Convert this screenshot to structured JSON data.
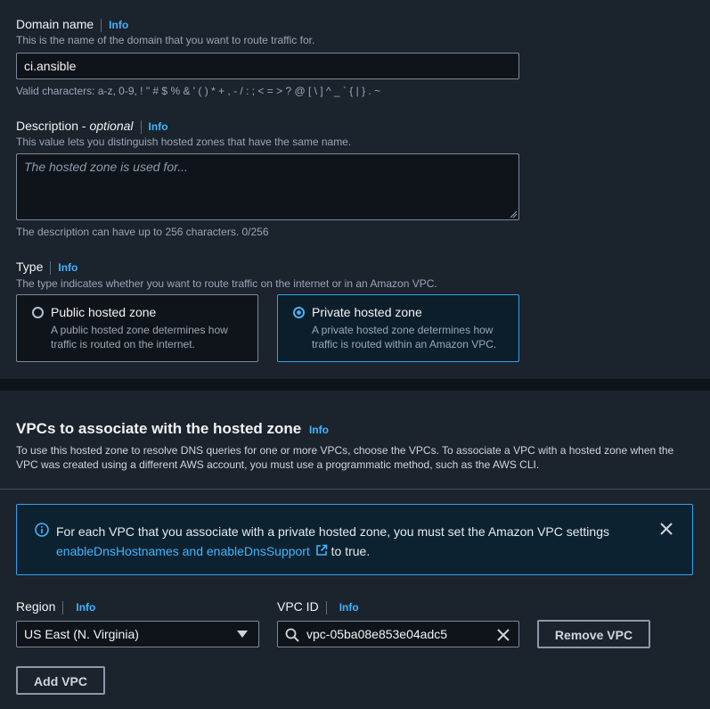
{
  "domain": {
    "label": "Domain name",
    "info": "Info",
    "hint": "This is the name of the domain that you want to route traffic for.",
    "value": "ci.ansible",
    "constraint": "Valid characters: a-z, 0-9, ! \" # $ % & ' ( ) * + , - / : ; < = > ? @ [ \\ ] ^ _ ` { | } . ~"
  },
  "description": {
    "label": "Description -",
    "label_optional": "optional",
    "info": "Info",
    "hint": "This value lets you distinguish hosted zones that have the same name.",
    "placeholder": "The hosted zone is used for...",
    "constraint": "The description can have up to 256 characters. 0/256"
  },
  "type": {
    "label": "Type",
    "info": "Info",
    "hint": "The type indicates whether you want to route traffic on the internet or in an Amazon VPC.",
    "options": [
      {
        "title": "Public hosted zone",
        "desc": "A public hosted zone determines how traffic is routed on the internet.",
        "selected": false
      },
      {
        "title": "Private hosted zone",
        "desc": "A private hosted zone determines how traffic is routed within an Amazon VPC.",
        "selected": true
      }
    ]
  },
  "vpcs": {
    "title": "VPCs to associate with the hosted zone",
    "info": "Info",
    "desc": "To use this hosted zone to resolve DNS queries for one or more VPCs, choose the VPCs. To associate a VPC with a hosted zone when the VPC was created using a different AWS account, you must use a programmatic method, such as the AWS CLI.",
    "alert": {
      "text": "For each VPC that you associate with a private hosted zone, you must set the Amazon VPC settings",
      "link": "enableDnsHostnames and enableDnsSupport",
      "suffix": "to true."
    },
    "region": {
      "label": "Region",
      "info": "Info",
      "value": "US East (N. Virginia)"
    },
    "vpc_id": {
      "label": "VPC ID",
      "info": "Info",
      "value": "vpc-05ba08e853e04adc5"
    },
    "remove_label": "Remove VPC",
    "add_label": "Add VPC"
  },
  "colors": {
    "accent": "#42b4ff",
    "panel": "#1b232d",
    "page": "#0f141a"
  }
}
